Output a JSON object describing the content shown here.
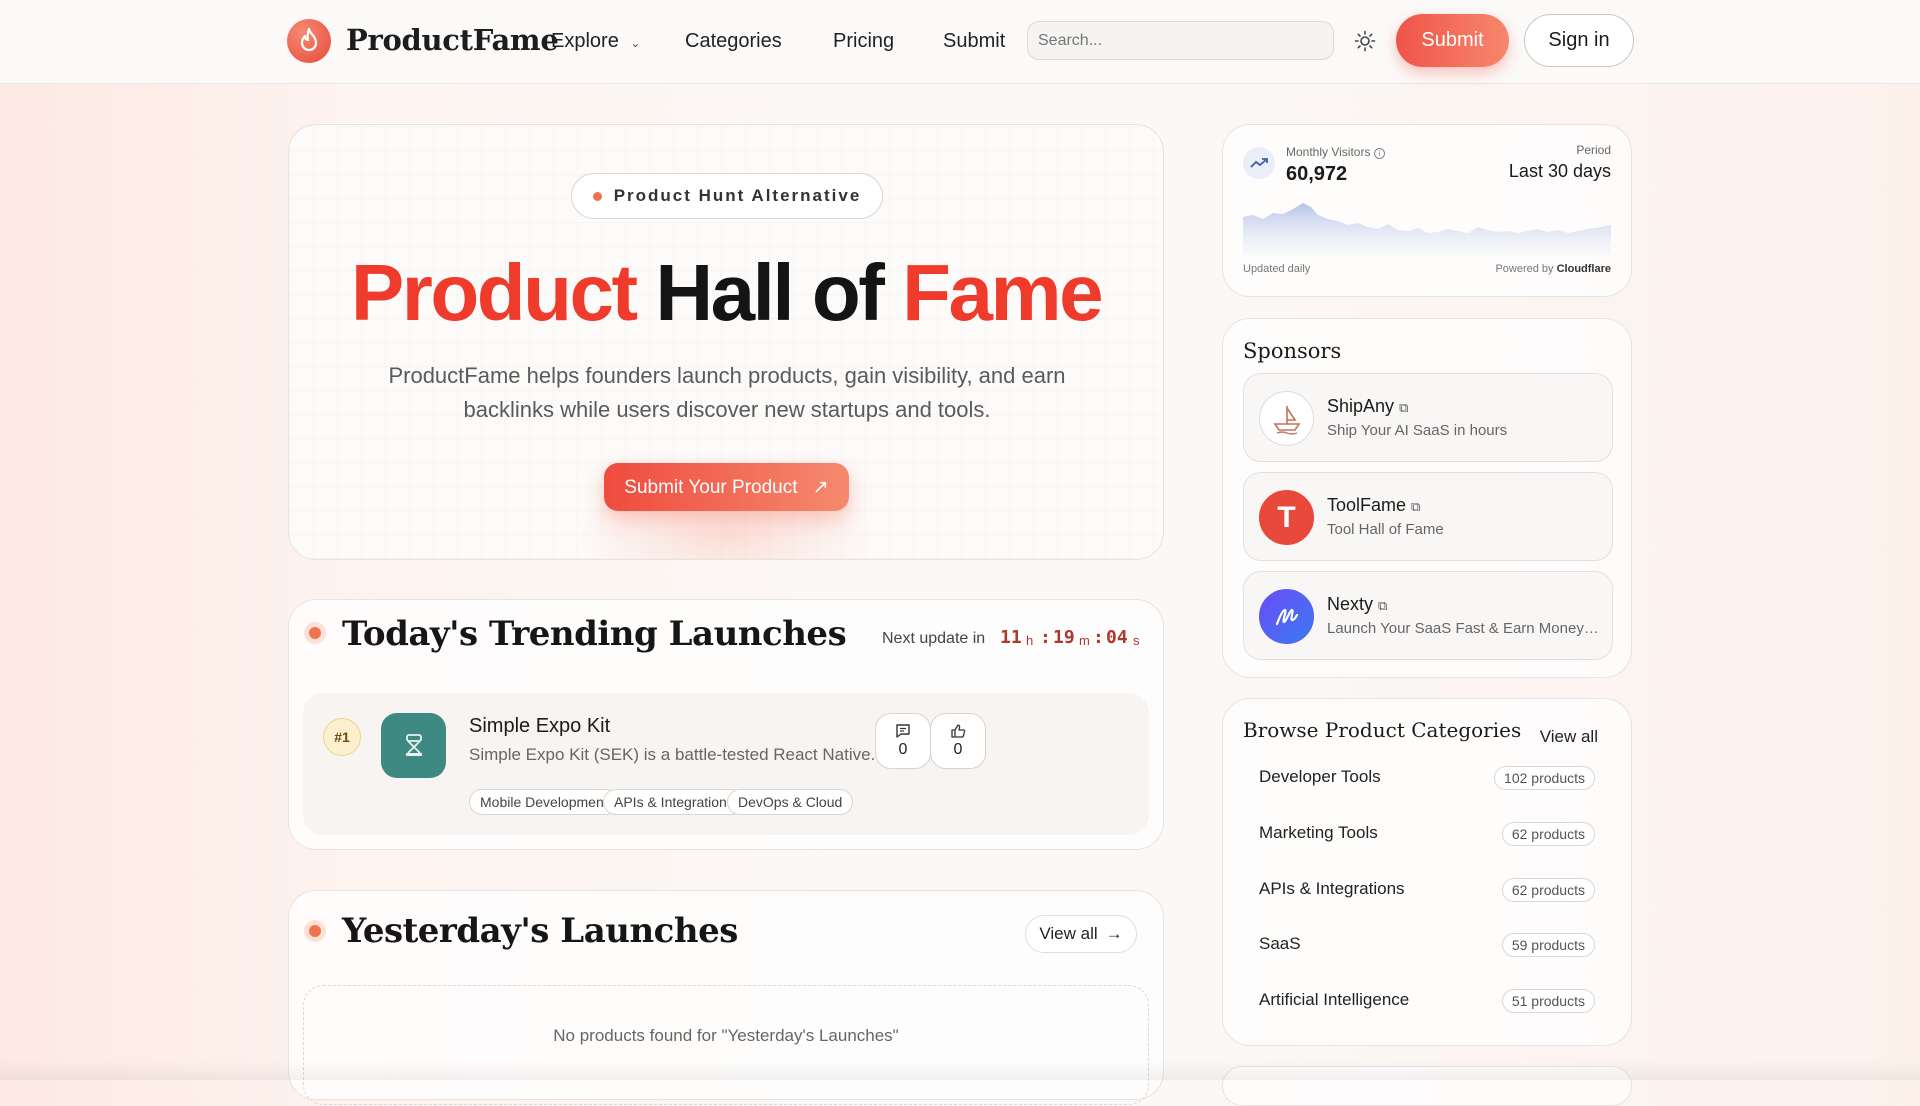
{
  "nav": {
    "brand": "ProductFame",
    "links": [
      "Explore",
      "Categories",
      "Pricing",
      "Submit"
    ],
    "search_placeholder": "Search...",
    "submit_label": "Submit",
    "signin_label": "Sign in"
  },
  "hero": {
    "badge": "Product Hunt Alternative",
    "title_part1": "Product",
    "title_part2": "Hall of",
    "title_part3": "Fame",
    "subtitle": "ProductFame helps founders launch products, gain visibility, and earn backlinks while users discover new startups and tools.",
    "cta": "Submit Your Product"
  },
  "trending": {
    "title": "Today's Trending Launches",
    "next_update_label": "Next update in",
    "countdown": {
      "h": "11",
      "m": "19",
      "s": "04",
      "h_unit": "h",
      "m_unit": "m",
      "s_unit": "s"
    },
    "products": [
      {
        "rank": "#1",
        "name": "Simple Expo Kit",
        "description": "Simple Expo Kit (SEK) is a battle-tested React Native...",
        "tags": [
          "Mobile Development",
          "APIs & Integrations",
          "DevOps & Cloud"
        ],
        "comments": "0",
        "upvotes": "0"
      }
    ]
  },
  "yesterday": {
    "title": "Yesterday's Launches",
    "view_all": "View all",
    "empty_text": "No products found for \"Yesterday's Launches\""
  },
  "visitors": {
    "label": "Monthly Visitors",
    "value": "60,972",
    "period_label": "Period",
    "period_value": "Last 30 days",
    "updated": "Updated daily",
    "powered_by": "Powered by",
    "powered_name": "Cloudflare"
  },
  "sponsors": {
    "title": "Sponsors",
    "items": [
      {
        "name": "ShipAny",
        "desc": "Ship Your AI SaaS in hours"
      },
      {
        "name": "ToolFame",
        "desc": "Tool Hall of Fame"
      },
      {
        "name": "Nexty",
        "desc": "Launch Your SaaS Fast & Earn Money Fast"
      }
    ]
  },
  "categories": {
    "title": "Browse Product Categories",
    "view_all": "View all",
    "items": [
      {
        "name": "Developer Tools",
        "count": "102 products"
      },
      {
        "name": "Marketing Tools",
        "count": "62 products"
      },
      {
        "name": "APIs & Integrations",
        "count": "62 products"
      },
      {
        "name": "SaaS",
        "count": "59 products"
      },
      {
        "name": "Artificial Intelligence",
        "count": "51 products"
      }
    ]
  },
  "colors": {
    "accent": "#ef3b2c",
    "accent_light": "#f7876c",
    "countdown": "#b0382b"
  }
}
